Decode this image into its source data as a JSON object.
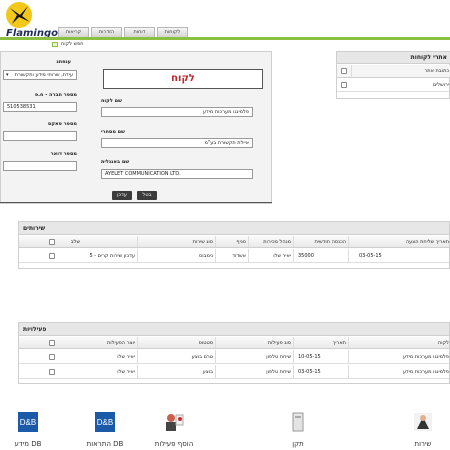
{
  "app": {
    "logo_text": "Flamingo"
  },
  "nav_tabs": [
    "קריאות",
    "הזדרות",
    "דוחות",
    "לקוחות"
  ],
  "new_customer_label": "חפש לקוח",
  "form": {
    "title": "לקוח",
    "labels": {
      "customer_name": "שם לקוח",
      "trade_name": "שם מסחרי",
      "english_name": "שם באנגלית",
      "industry": "ענפתנ",
      "company_number": "מספר חברה - ח.פ",
      "fax": "מספר פאקס",
      "phone": "מספר דואר"
    },
    "values": {
      "customer_name": "פלמינגו מערכות מידע",
      "trade_name": "איילת תקשורת בע\"מ",
      "english_name": "AYELET COMMUNICATION LTD.",
      "industry": "עידת, שרותי מידע ותקשורת",
      "company_number": "510538531",
      "fax": "",
      "phone": ""
    },
    "buttons": {
      "save": "עדכן",
      "cancel": "בטל"
    }
  },
  "contacts": {
    "title": "אתרי לקוחות",
    "columns": [
      "כתובת אתר"
    ],
    "rows": [
      {
        "site": "ירושלים"
      }
    ]
  },
  "services": {
    "title": "שירותים",
    "columns": [
      "תאריך שליחת הצעה",
      "הכנסה חודשית",
      "מנהל מכירות",
      "סניף",
      "סוג שירות",
      "שלב"
    ],
    "rows": [
      {
        "date": "03-05-15",
        "income": "35000",
        "manager": "יאיר שלו",
        "branch": "אשדוד",
        "type": "נימבוס",
        "stage": "עדכון שירות קרים - 5"
      }
    ]
  },
  "activities": {
    "title": "פעילויות",
    "columns": [
      "לקוח",
      "תאריך",
      "סוג פעילות",
      "סטטוס",
      "יוצר הפעילות"
    ],
    "rows": [
      {
        "customer": "פלמינגו מערכות מידע",
        "date": "10-05-15",
        "type": "שיחת טלפון",
        "status": "טרם בוצע",
        "creator": "יאיר שלו"
      },
      {
        "customer": "פלמינגו מערכות מידע",
        "date": "03-05-15",
        "type": "שיחת טלפון",
        "status": "בוצע",
        "creator": "יאיר שלו"
      }
    ]
  },
  "toolbar": [
    {
      "label": "שירות",
      "icon": "service-icon"
    },
    {
      "label": "תקן",
      "icon": "printer-icon"
    },
    {
      "label": "הוסף פעילות",
      "icon": "add-activity-icon"
    },
    {
      "label": "התראות DB",
      "icon": "db-alerts-icon"
    },
    {
      "label": "מידע DB",
      "icon": "db-info-icon"
    }
  ],
  "colors": {
    "accent_green": "#8bbf3f",
    "title_red": "#c0272d",
    "logo_yellow": "#f4c81a",
    "logo_navy": "#1e2d5c",
    "db_blue": "#1a5aa8"
  }
}
